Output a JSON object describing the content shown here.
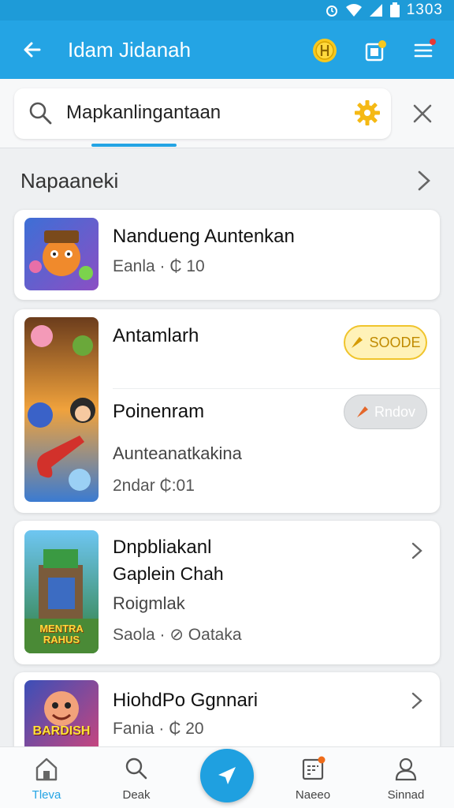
{
  "status_bar": {
    "time": "1303"
  },
  "app_bar": {
    "title": "Idam Jidanah"
  },
  "search": {
    "value": "Mapkanlingantaan"
  },
  "section": {
    "title": "Napaaneki"
  },
  "cards": [
    {
      "title": "Nandueng Auntenkan",
      "subtitle": "Eanla · ₵ 10"
    },
    {
      "title": "Antamlarh",
      "badge": "SOODE",
      "title2": "Poinenram",
      "badge2": "Rndov",
      "subtitle": "Aunteanatkakina",
      "subtitle2": "2ndar ₵:01"
    },
    {
      "title": "Dnpbliakanl",
      "line2": "Gaplein Chah",
      "line3": "Roigmlak",
      "subtitle": "Saola · ⊘ Oataka",
      "thumb_label": "MENTRA RAHUS"
    },
    {
      "title": "HiohdPo Ggnnari",
      "subtitle": "Fania · ₵ 20",
      "thumb_label": "BARDISH"
    }
  ],
  "bottom_nav": [
    {
      "label": "Tleva",
      "icon": "home-icon",
      "active": true
    },
    {
      "label": "Deak",
      "icon": "search-icon"
    },
    {
      "label": "",
      "icon": "send-icon"
    },
    {
      "label": "Naeeo",
      "icon": "calendar-icon"
    },
    {
      "label": "Sinnad",
      "icon": "profile-icon"
    }
  ],
  "colors": {
    "primary": "#24a4e4",
    "gold": "#f0c42c",
    "badge_dot": "#e53935"
  }
}
